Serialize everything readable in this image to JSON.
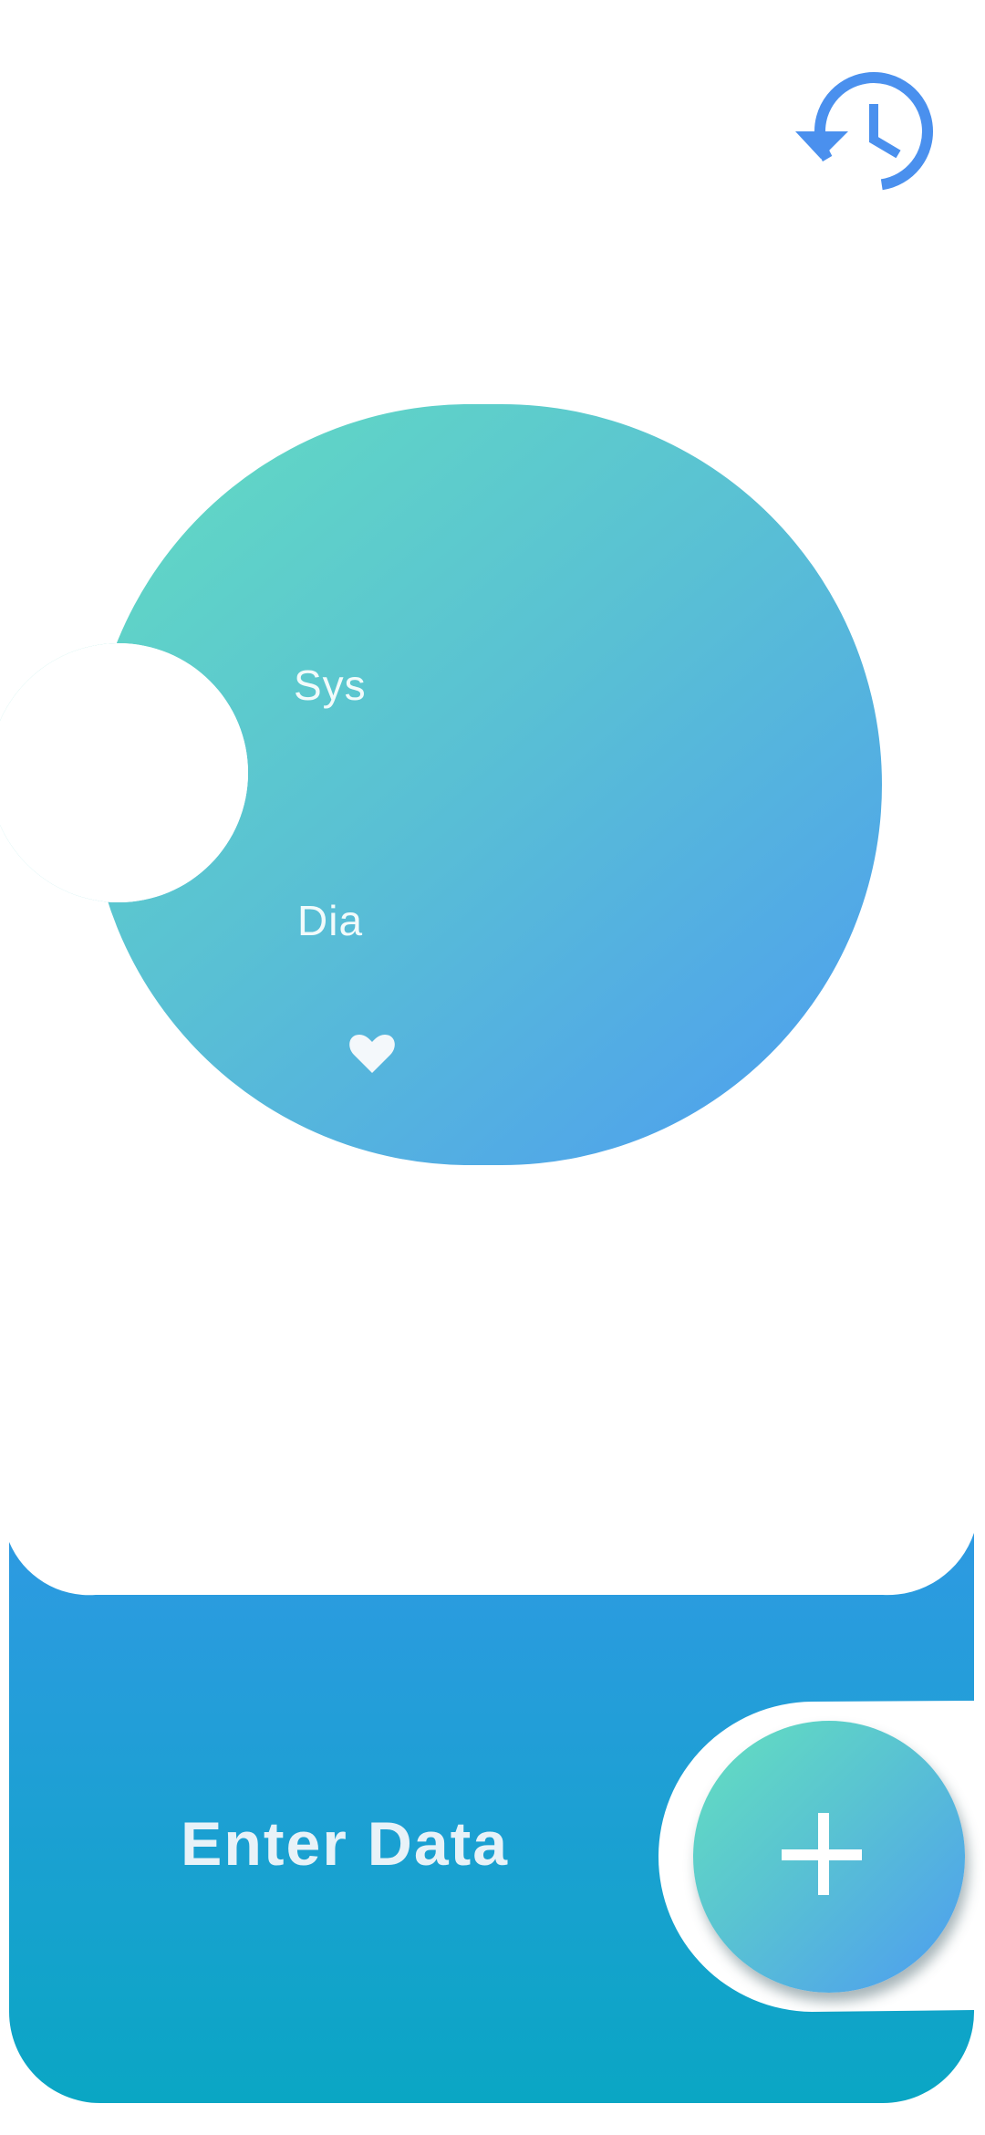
{
  "header": {
    "history_icon": "history-icon"
  },
  "gauge": {
    "sys_label": "Sys",
    "dia_label": "Dia",
    "heart_icon": "heart-icon",
    "gradient_start": "#64e0bf",
    "gradient_end": "#4d9cf1"
  },
  "entry": {
    "label": "Enter Data",
    "add_icon": "plus-icon",
    "panel_color_top": "#2e9ae2",
    "panel_color_bottom": "#0aa6c4"
  }
}
